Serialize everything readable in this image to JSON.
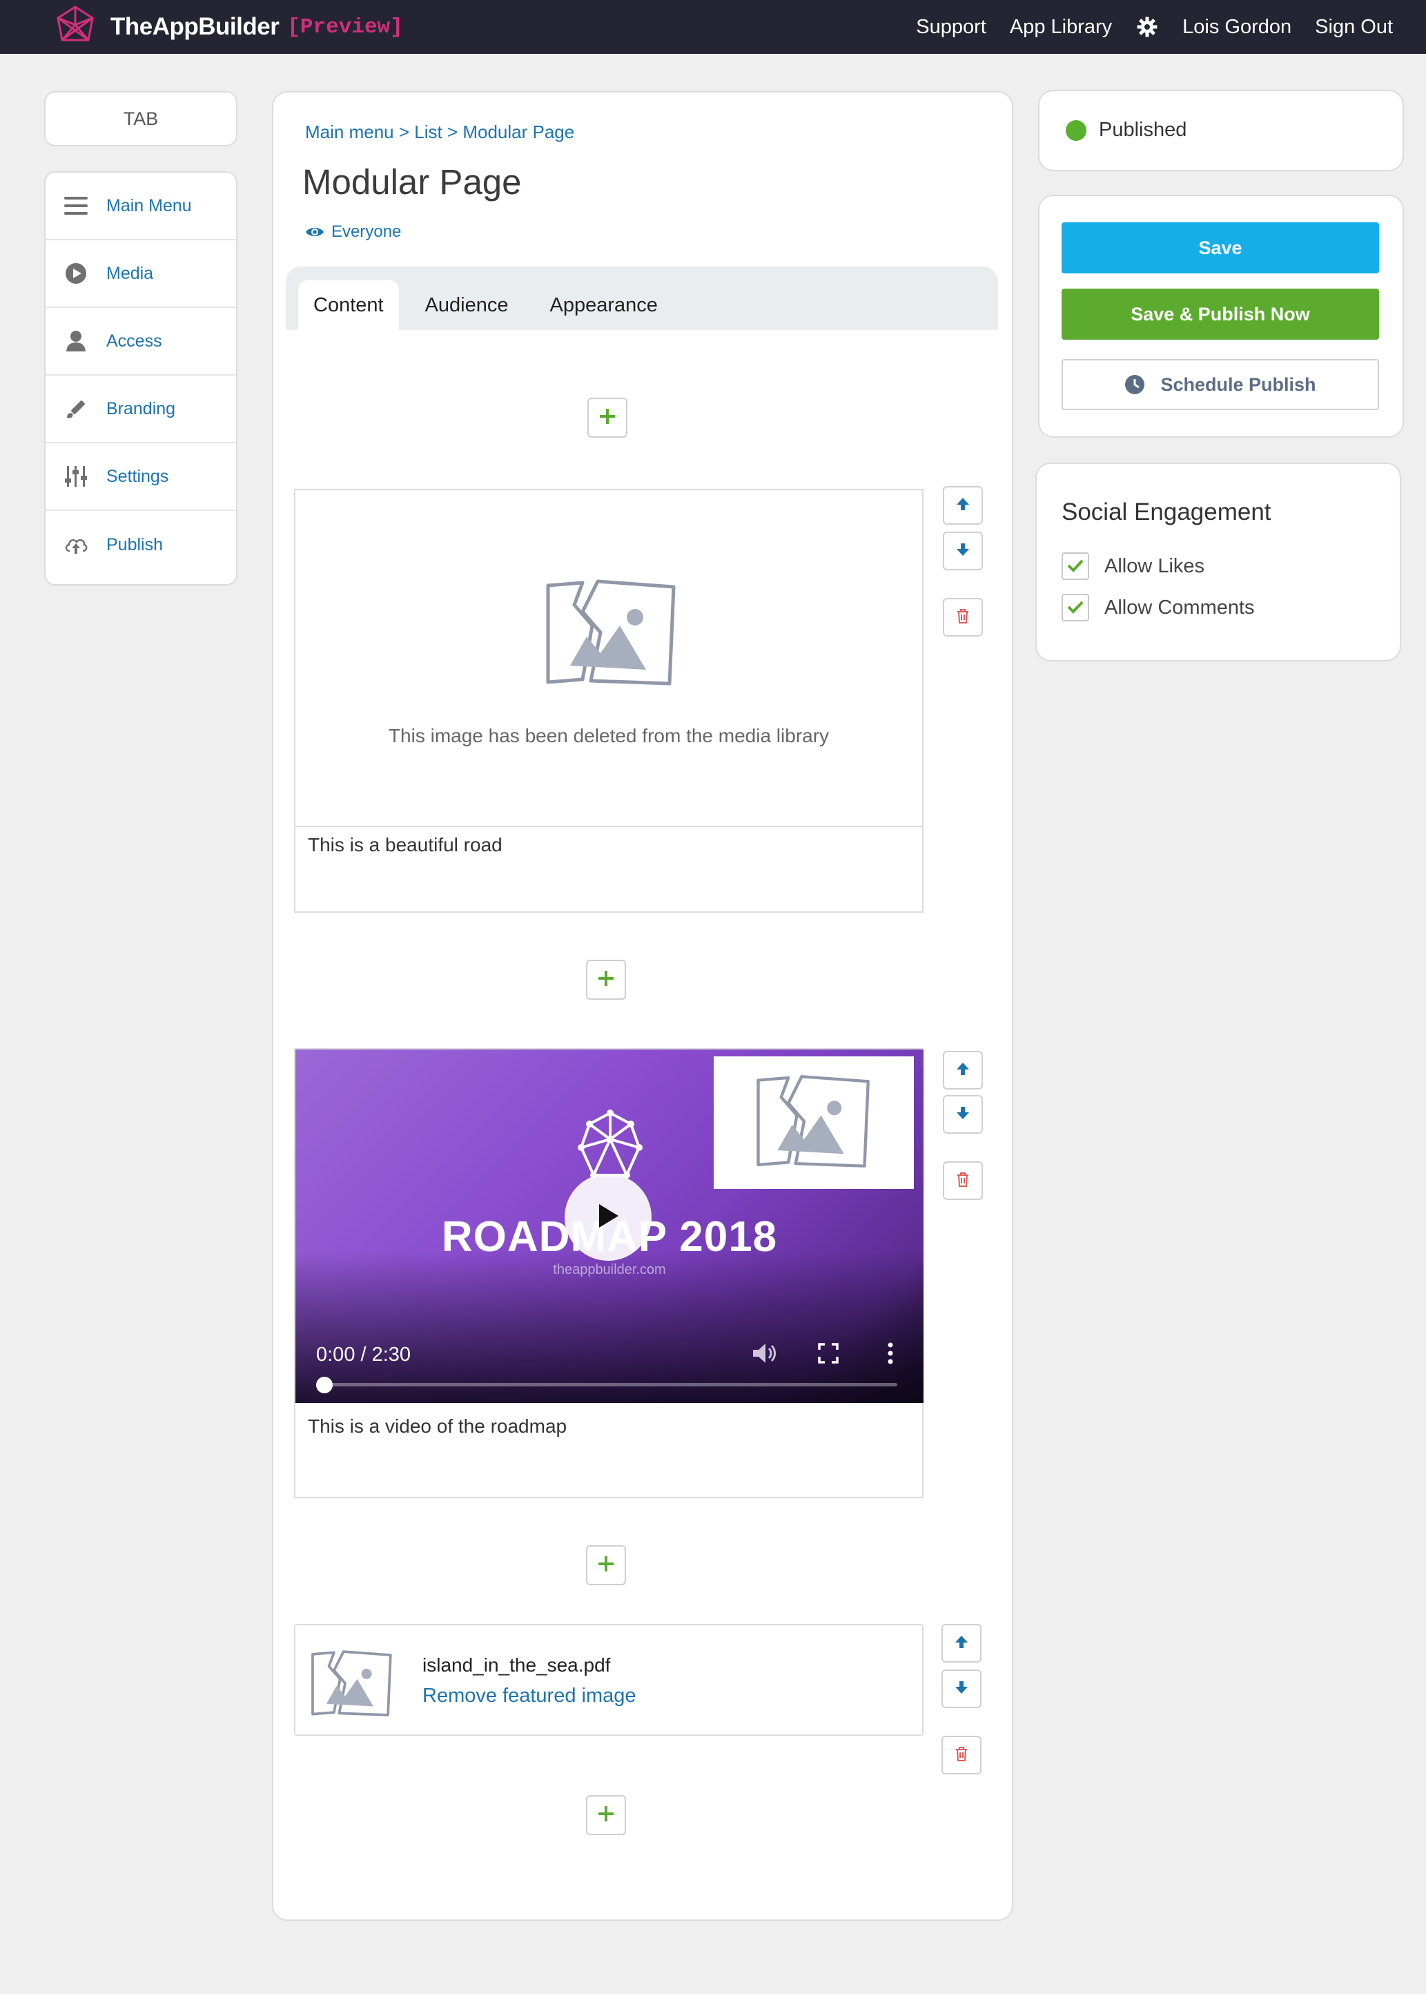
{
  "brand": {
    "name": "TheAppBuilder",
    "tag": "[Preview]",
    "accent": "#d22e7e"
  },
  "topnav": {
    "support": "Support",
    "app_library": "App Library",
    "settings_icon": "gear-icon",
    "user": "Lois Gordon",
    "sign_out": "Sign Out"
  },
  "sidebar": {
    "tab_label": "TAB",
    "items": [
      {
        "label": "Main Menu",
        "icon": "hamburger-icon"
      },
      {
        "label": "Media",
        "icon": "play-circle-icon"
      },
      {
        "label": "Access",
        "icon": "user-icon"
      },
      {
        "label": "Branding",
        "icon": "paintbrush-icon"
      },
      {
        "label": "Settings",
        "icon": "sliders-icon"
      },
      {
        "label": "Publish",
        "icon": "cloud-upload-icon"
      }
    ]
  },
  "main": {
    "breadcrumb": "Main menu > List > Modular Page",
    "title": "Modular Page",
    "audience": "Everyone",
    "tabs": [
      "Content",
      "Audience",
      "Appearance"
    ],
    "active_tab": "Content",
    "modules": {
      "image": {
        "deleted_message": "This image has been deleted from the media library",
        "caption": "This is a beautiful road"
      },
      "video": {
        "title_overlay": "ROADMAP 2018",
        "url_overlay": "theappbuilder.com",
        "time": "0:00 / 2:30",
        "caption": "This is a video of the roadmap",
        "progress": 0
      },
      "file": {
        "name": "island_in_the_sea.pdf",
        "action": "Remove featured image"
      }
    }
  },
  "publish": {
    "status": "Published",
    "status_color": "#58b02e",
    "save": "Save",
    "save_publish": "Save & Publish Now",
    "schedule": "Schedule Publish"
  },
  "social": {
    "title": "Social Engagement",
    "allow_likes": "Allow Likes",
    "allow_comments": "Allow Comments",
    "likes_checked": true,
    "comments_checked": true
  },
  "colors": {
    "link": "#1a74b0",
    "save": "#15aee8",
    "publish": "#5cab2e",
    "topbar": "#252433",
    "delete": "#e05a5a",
    "arrow": "#1a74b0"
  }
}
